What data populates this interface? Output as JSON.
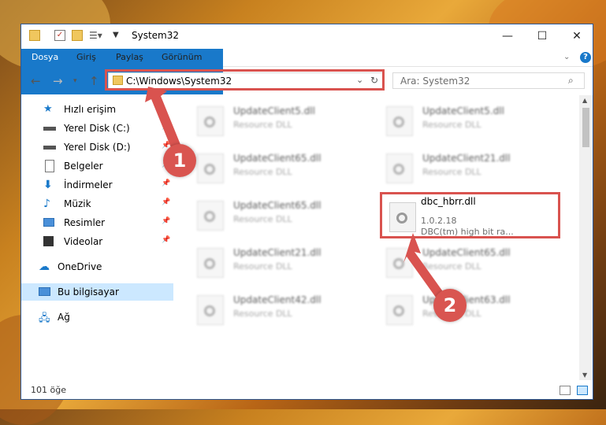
{
  "window": {
    "title": "System32",
    "controls": [
      "minimize",
      "maximize",
      "close"
    ]
  },
  "ribbon": {
    "tabs": [
      "Dosya",
      "Giriş",
      "Paylaş",
      "Görünüm"
    ],
    "help_icon": "help-icon"
  },
  "address_bar": {
    "path": "C:\\Windows\\System32",
    "search_placeholder": "Ara: System32"
  },
  "sidebar": {
    "items": [
      {
        "label": "Hızlı erişim",
        "icon": "star-icon",
        "pinned": false
      },
      {
        "label": "Yerel Disk (C:)",
        "icon": "drive-icon",
        "pinned": true
      },
      {
        "label": "Yerel Disk (D:)",
        "icon": "drive-icon",
        "pinned": true
      },
      {
        "label": "Belgeler",
        "icon": "documents-icon",
        "pinned": true
      },
      {
        "label": "İndirmeler",
        "icon": "downloads-icon",
        "pinned": true
      },
      {
        "label": "Müzik",
        "icon": "music-icon",
        "pinned": true
      },
      {
        "label": "Resimler",
        "icon": "pictures-icon",
        "pinned": true
      },
      {
        "label": "Videolar",
        "icon": "videos-icon",
        "pinned": true
      },
      {
        "label": "OneDrive",
        "icon": "cloud-icon",
        "pinned": false
      },
      {
        "label": "Bu bilgisayar",
        "icon": "computer-icon",
        "pinned": false,
        "selected": true
      },
      {
        "label": "Ağ",
        "icon": "network-icon",
        "pinned": false
      }
    ]
  },
  "files": [
    {
      "name": "UpdateClient5.dll",
      "desc": "Resource DLL"
    },
    {
      "name": "UpdateClient5.dll",
      "desc": "Resource DLL"
    },
    {
      "name": "UpdateClient65.dll",
      "desc": "Resource DLL"
    },
    {
      "name": "UpdateClient21.dll",
      "desc": "Resource DLL"
    },
    {
      "name": "UpdateClient65.dll",
      "desc": "Resource DLL"
    },
    {
      "name": "dbc_hbrr.dll",
      "version": "1.0.2.18",
      "desc": "DBC(tm) high bit ra..."
    },
    {
      "name": "UpdateClient21.dll",
      "desc": "Resource DLL"
    },
    {
      "name": "UpdateClient65.dll",
      "desc": "Resource DLL"
    },
    {
      "name": "UpdateClient42.dll",
      "desc": "Resource DLL"
    },
    {
      "name": "UpdateClient63.dll",
      "desc": "Resource DLL"
    }
  ],
  "status": {
    "item_count": "101 öğe"
  },
  "annotations": {
    "badge1": "1",
    "badge2": "2",
    "color": "#d9534f"
  }
}
